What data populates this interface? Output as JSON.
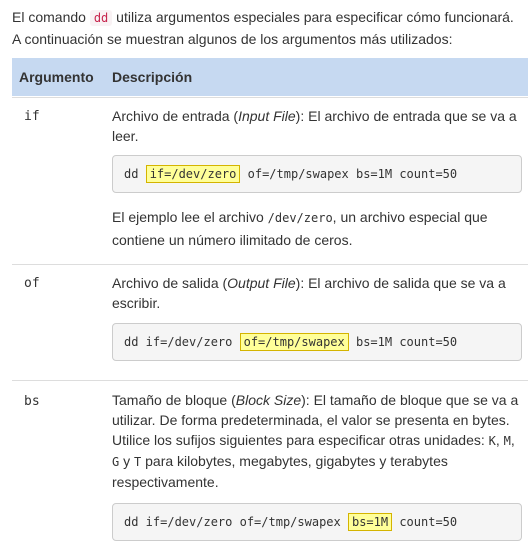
{
  "intro": {
    "before": "El comando",
    "command": "dd",
    "after_line1": " utiliza argumentos especiales para especificar cómo funcionará.",
    "line2": "A continuación se muestran algunos de los argumentos más utilizados:"
  },
  "table": {
    "headers": [
      "Argumento",
      "Descripción"
    ],
    "rows": [
      {
        "arg": "if",
        "desc_before": "Archivo de entrada (",
        "desc_italic": "Input File",
        "desc_after": "): El archivo de entrada que se va a leer.",
        "code_pre": "dd ",
        "code_hl": "if=/dev/zero",
        "code_post": " of=/tmp/swapex bs=1M count=50",
        "note_before": "El ejemplo lee el archivo ",
        "note_code": "/dev/zero",
        "note_after": ", un archivo especial que contiene un número ilimitado de ceros."
      },
      {
        "arg": "of",
        "desc_before": "Archivo de salida (",
        "desc_italic": "Output File",
        "desc_after": "): El archivo de salida que se va a escribir.",
        "code_pre": "dd if=/dev/zero ",
        "code_hl": "of=/tmp/swapex",
        "code_post": " bs=1M count=50"
      },
      {
        "arg": "bs",
        "desc_before": "Tamaño de bloque (",
        "desc_italic": "Block Size",
        "desc_after": "): El tamaño de bloque que se va a utilizar. De forma predeterminada, el valor se presenta en bytes. Utilice los sufijos siguientes para especificar otras unidades: ",
        "units": [
          "K",
          "M",
          "G",
          "T"
        ],
        "unit_sep": ",",
        "unit_and": "y",
        "desc_end": " para kilobytes, megabytes, gigabytes y terabytes respectivamente.",
        "code_pre": "dd if=/dev/zero of=/tmp/swapex ",
        "code_hl": "bs=1M",
        "code_post": " count=50"
      }
    ]
  }
}
